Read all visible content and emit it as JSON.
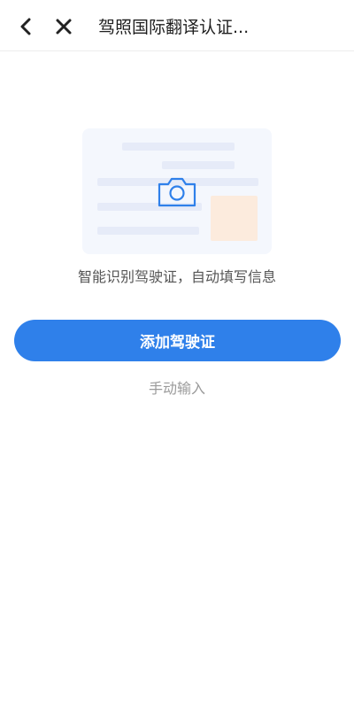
{
  "header": {
    "title": "驾照国际翻译认证...",
    "back_icon": "chevron-left-icon",
    "close_icon": "close-icon"
  },
  "illustration": {
    "icon": "camera-icon",
    "colors": {
      "card_bg": "#f4f7fd",
      "line": "#e6ebf8",
      "photo": "#fcebdd",
      "camera": "#2f80ea"
    }
  },
  "main": {
    "subtitle": "智能识别驾驶证，自动填写信息",
    "add_button_label": "添加驾驶证",
    "manual_link": "手动输入"
  },
  "colors": {
    "accent": "#2f80ea"
  }
}
